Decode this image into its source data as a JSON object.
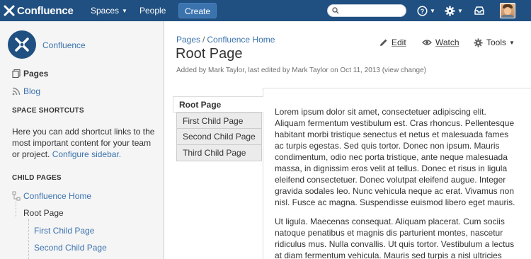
{
  "header": {
    "brand": "Confluence",
    "nav": {
      "spaces": "Spaces",
      "people": "People"
    },
    "create_label": "Create",
    "search_placeholder": "",
    "help_icon": "help-icon",
    "settings_icon": "gear-icon",
    "notifications_icon": "inbox-icon",
    "colors": {
      "bar": "#205081",
      "create": "#3b73af"
    }
  },
  "sidebar": {
    "space_name": "Confluence",
    "pages_label": "Pages",
    "blog_label": "Blog",
    "shortcuts_heading": "SPACE SHORTCUTS",
    "shortcuts_text": "Here you can add shortcut links to the most important content for your team or project.",
    "configure_link": "Configure sidebar.",
    "child_pages_heading": "CHILD PAGES",
    "tree": [
      {
        "label": "Confluence Home",
        "level": 0
      },
      {
        "label": "Root Page",
        "level": 1
      },
      {
        "label": "First Child Page",
        "level": 2
      },
      {
        "label": "Second Child Page",
        "level": 2
      }
    ]
  },
  "page": {
    "breadcrumb": [
      "Pages",
      "Confluence Home"
    ],
    "breadcrumb_sep": "/",
    "title": "Root Page",
    "byline": "Added by Mark Taylor, last edited by Mark Taylor on Oct 11, 2013",
    "view_change": "(view change)",
    "actions": {
      "edit": "Edit",
      "watch": "Watch",
      "tools": "Tools"
    }
  },
  "tabs": [
    "Root Page",
    "First Child Page",
    "Second Child Page",
    "Third Child Page"
  ],
  "content": {
    "para1": "Lorem ipsum dolor sit amet, consectetuer adipiscing elit. Aliquam fermentum vestibulum est. Cras rhoncus. Pellentesque habitant morbi tristique senectus et netus et malesuada fames ac turpis egestas. Sed quis tortor. Donec non ipsum. Mauris condimentum, odio nec porta tristique, ante neque malesuada massa, in dignissim eros velit at tellus. Donec et risus in ligula eleifend consectetuer. Donec volutpat eleifend augue. Integer gravida sodales leo. Nunc vehicula neque ac erat. Vivamus non nisl. Fusce ac magna. Suspendisse euismod libero eget mauris.",
    "para2": "Ut ligula. Maecenas consequat. Aliquam placerat. Cum sociis natoque penatibus et magnis dis parturient montes, nascetur ridiculus mus. Nulla convallis. Ut quis tortor. Vestibulum a lectus at diam fermentum vehicula. Mauris sed turpis a nisl ultricies"
  }
}
